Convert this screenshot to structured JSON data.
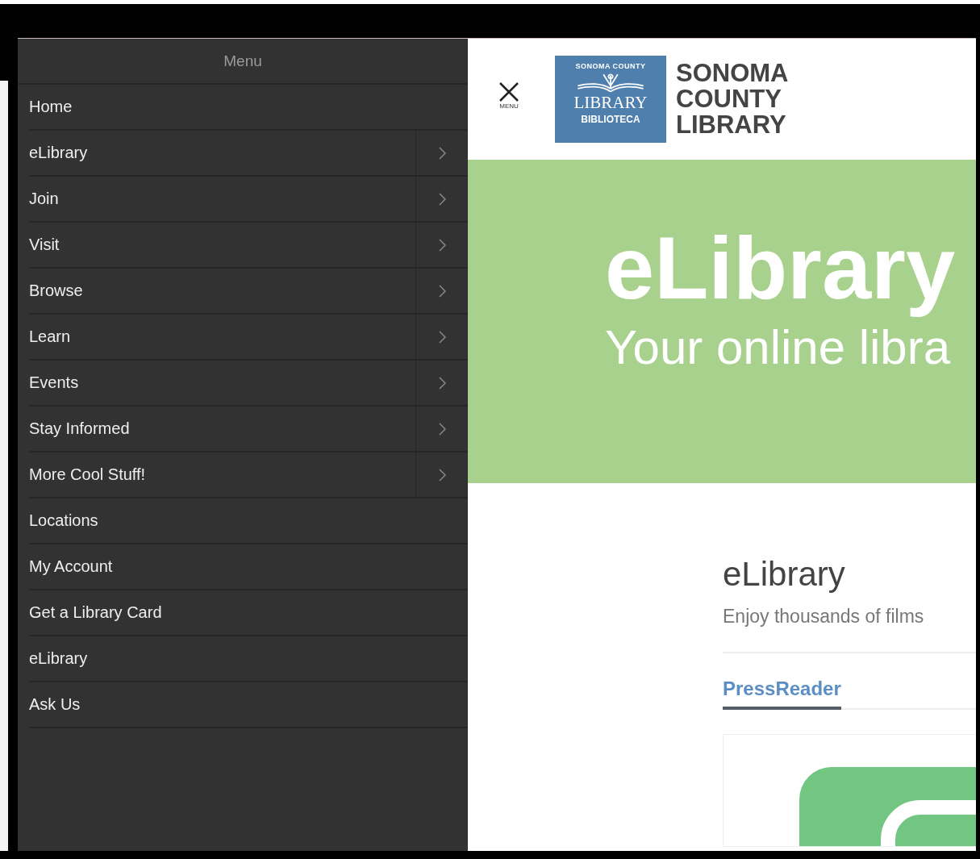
{
  "menu": {
    "title": "Menu",
    "items": [
      {
        "label": "Home",
        "has_submenu": false
      },
      {
        "label": "eLibrary",
        "has_submenu": true
      },
      {
        "label": "Join",
        "has_submenu": true
      },
      {
        "label": "Visit",
        "has_submenu": true
      },
      {
        "label": "Browse",
        "has_submenu": true
      },
      {
        "label": "Learn",
        "has_submenu": true
      },
      {
        "label": "Events",
        "has_submenu": true
      },
      {
        "label": "Stay Informed",
        "has_submenu": true
      },
      {
        "label": "More Cool Stuff!",
        "has_submenu": true
      },
      {
        "label": "Locations",
        "has_submenu": false
      },
      {
        "label": "My Account",
        "has_submenu": false
      },
      {
        "label": "Get a Library Card",
        "has_submenu": false
      },
      {
        "label": "eLibrary",
        "has_submenu": false
      },
      {
        "label": "Ask Us",
        "has_submenu": false
      }
    ]
  },
  "header": {
    "close_label": "MENU",
    "logo": {
      "arc_text": "SONOMA COUNTY",
      "main": "LIBRARY",
      "sub": "BIBLIOTECA"
    },
    "site_name": [
      "SONOMA",
      "COUNTY",
      "LIBRARY"
    ]
  },
  "banner": {
    "title": "eLibrary",
    "subtitle": "Your online libra"
  },
  "section": {
    "title": "eLibrary",
    "description": "Enjoy thousands of films",
    "tabs": [
      {
        "label": "PressReader",
        "selected": true
      }
    ]
  }
}
